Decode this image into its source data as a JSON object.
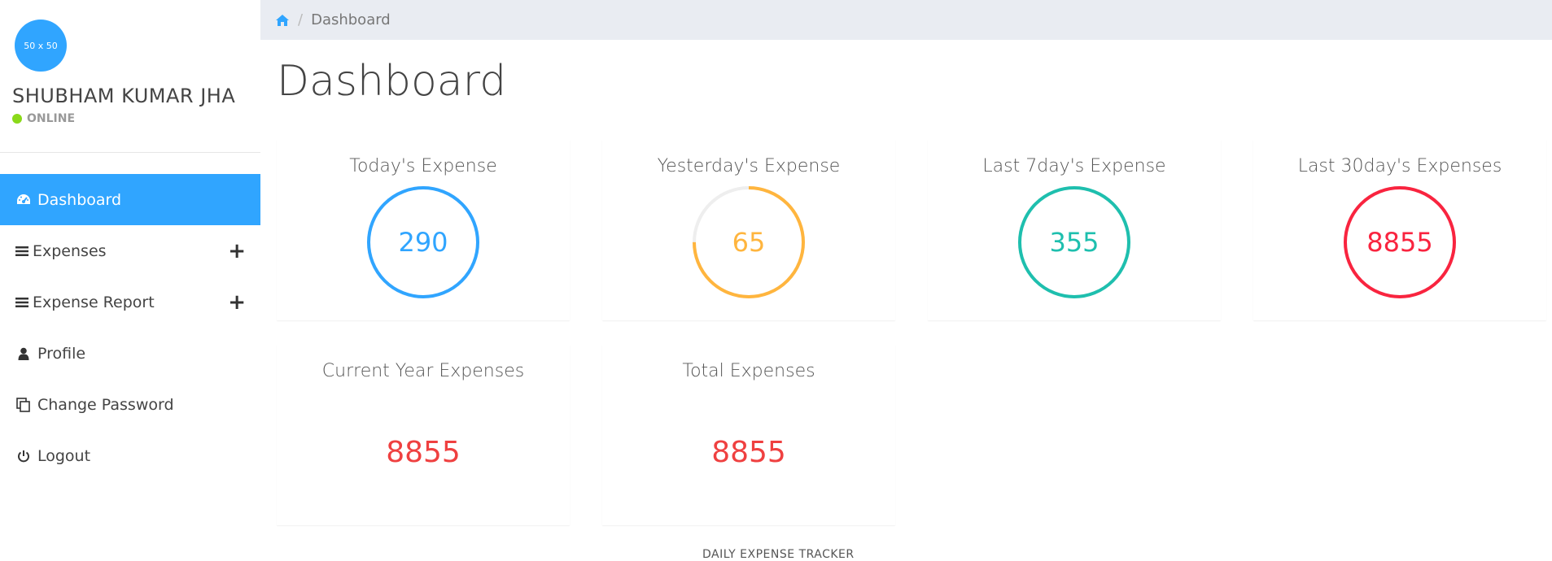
{
  "user": {
    "avatar_text": "50 x 50",
    "name": "SHUBHAM KUMAR JHA",
    "status": "ONLINE"
  },
  "sidebar": {
    "items": [
      {
        "label": "Dashboard",
        "icon": "dashboard-icon",
        "active": true
      },
      {
        "label": "Expenses",
        "icon": "list-icon",
        "expandable": true
      },
      {
        "label": "Expense Report",
        "icon": "list-icon",
        "expandable": true
      },
      {
        "label": "Profile",
        "icon": "user-icon"
      },
      {
        "label": "Change Password",
        "icon": "copy-icon"
      },
      {
        "label": "Logout",
        "icon": "power-icon"
      }
    ],
    "plus_symbol": "+"
  },
  "breadcrumb": {
    "separator": "/",
    "current": "Dashboard"
  },
  "page": {
    "title": "Dashboard"
  },
  "cards": {
    "today": {
      "title": "Today's Expense",
      "value": "290",
      "color": "#30a5ff",
      "fill": 1.0
    },
    "yesterday": {
      "title": "Yesterday's Expense",
      "value": "65",
      "color": "#ffb53e",
      "fill": 0.75
    },
    "last7": {
      "title": "Last 7day's Expense",
      "value": "355",
      "color": "#1ebfae",
      "fill": 1.0
    },
    "last30": {
      "title": "Last 30day's Expenses",
      "value": "8855",
      "color": "#f9243f",
      "fill": 1.0
    },
    "current_year": {
      "title": "Current Year Expenses",
      "value": "8855"
    },
    "total": {
      "title": "Total Expenses",
      "value": "8855"
    }
  },
  "footer": {
    "text": "DAILY EXPENSE TRACKER"
  },
  "colors": {
    "accent": "#30a5ff",
    "online": "#8ad919",
    "value_red": "#ef4040"
  }
}
